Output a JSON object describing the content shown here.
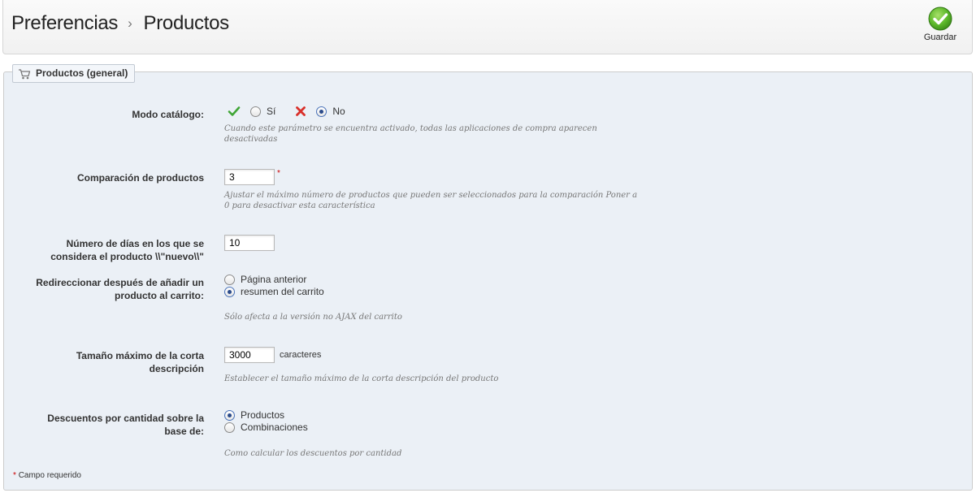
{
  "header": {
    "breadcrumb_parent": "Preferencias",
    "separator": "›",
    "breadcrumb_current": "Productos",
    "save_label": "Guardar"
  },
  "section": {
    "legend": "Productos (general)",
    "legend_icon": "cart-icon"
  },
  "catalog_mode": {
    "label": "Modo catálogo:",
    "yes_label": "Sí",
    "no_label": "No",
    "selected": "No",
    "hint": "Cuando este parámetro se encuentra activado, todas las aplicaciones de compra aparecen desactivadas"
  },
  "product_comparison": {
    "label": "Comparación de productos",
    "value": "3",
    "required_mark": "*",
    "hint": "Ajustar el máximo número de productos que pueden ser seleccionados para la comparación Poner a 0 para desactivar esta característica"
  },
  "new_days": {
    "label": "Número de días en los que se considera el producto \\\\\"nuevo\\\\\"",
    "value": "10"
  },
  "redirect_after_add": {
    "label": "Redireccionar después de añadir un producto al carrito:",
    "options": [
      "Página anterior",
      "resumen del carrito"
    ],
    "selected": "resumen del carrito",
    "hint": "Sólo afecta a la versión no AJAX del carrito"
  },
  "short_desc_size": {
    "label": "Tamaño máximo de la corta descripción",
    "value": "3000",
    "unit": "caracteres",
    "hint": "Establecer el tamaño máximo de la corta descripción del producto"
  },
  "quantity_discounts": {
    "label": "Descuentos por cantidad sobre la base de:",
    "options": [
      "Productos",
      "Combinaciones"
    ],
    "selected": "Productos",
    "hint": "Como calcular los descuentos por cantidad"
  },
  "footnote": {
    "star": "*",
    "text": "Campo requerido"
  },
  "colors": {
    "panel_bg": "#ebf0f6",
    "required": "#cc0000",
    "check_green": "#3fa535",
    "cross_red": "#d9302a"
  }
}
